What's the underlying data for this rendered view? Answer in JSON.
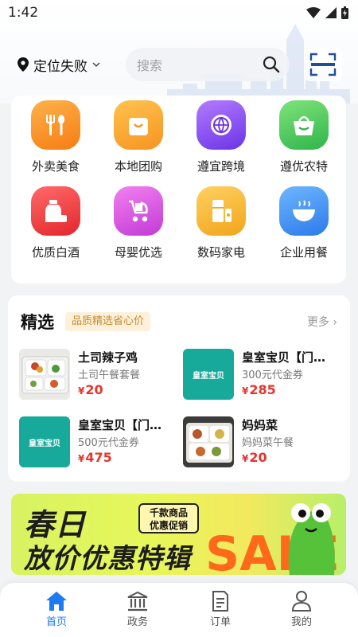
{
  "status": {
    "time": "1:42"
  },
  "header": {
    "location": "定位失败",
    "search_placeholder": "搜索"
  },
  "categories": [
    {
      "label": "外卖美食",
      "icon": "fork-spoon-icon",
      "color": "#f7931e"
    },
    {
      "label": "本地团购",
      "icon": "shopping-bag-icon",
      "color": "#f7a62a"
    },
    {
      "label": "遵宜跨境",
      "icon": "globe-icon",
      "color": "#8a4ff2"
    },
    {
      "label": "遵优农特",
      "icon": "basket-icon",
      "color": "#4cc85a"
    },
    {
      "label": "优质白酒",
      "icon": "liquor-bottle-icon",
      "color": "#ef3d3d"
    },
    {
      "label": "母婴优选",
      "icon": "stroller-icon",
      "color": "#d44fe0"
    },
    {
      "label": "数码家电",
      "icon": "appliance-icon",
      "color": "#f5b52a"
    },
    {
      "label": "企业用餐",
      "icon": "rice-bowl-icon",
      "color": "#3b8ef0"
    }
  ],
  "featured": {
    "title": "精选",
    "tag": "品质精选省心价",
    "more": "更多",
    "products": [
      {
        "name": "土司辣子鸡",
        "desc": "土司午餐套餐",
        "currency": "¥",
        "price": "20",
        "image": "food-tray-image"
      },
      {
        "name": "皇室宝贝【门…",
        "desc": "300元代金券",
        "currency": "¥",
        "price": "285",
        "image": "brand-logo-image",
        "logo_text": "皇室宝贝"
      },
      {
        "name": "皇室宝贝【门…",
        "desc": "500元代金券",
        "currency": "¥",
        "price": "475",
        "image": "brand-logo-image",
        "logo_text": "皇室宝贝"
      },
      {
        "name": "妈妈菜",
        "desc": "妈妈菜午餐",
        "currency": "¥",
        "price": "20",
        "image": "food-tray-image"
      }
    ]
  },
  "banner": {
    "line1": "春日",
    "line2": "放价优惠特辑",
    "badge_line1": "千款商品",
    "badge_line2": "优惠促销",
    "deco": "SALE"
  },
  "nav": [
    {
      "label": "首页",
      "icon": "home-icon",
      "active": true
    },
    {
      "label": "政务",
      "icon": "government-building-icon",
      "active": false
    },
    {
      "label": "订单",
      "icon": "order-list-icon",
      "active": false
    },
    {
      "label": "我的",
      "icon": "user-profile-icon",
      "active": false
    }
  ],
  "colors": {
    "accent": "#1e7cf2",
    "price": "#e5352e",
    "brand_teal": "#17a99a"
  }
}
